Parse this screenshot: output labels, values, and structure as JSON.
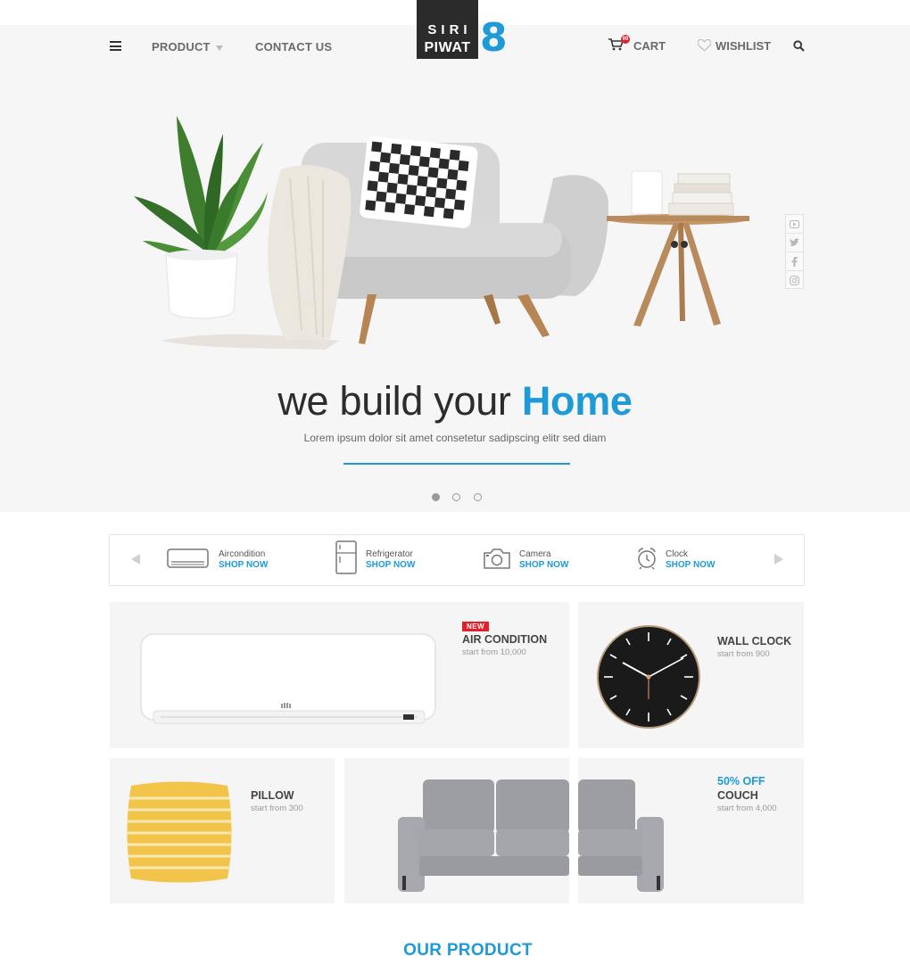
{
  "header": {
    "product_label": "PRODUCT",
    "contact_label": "CONTACT US",
    "logo_line1": "SIRI",
    "logo_line2": "PIWAT",
    "logo_digit": "8",
    "cart_label": "CART",
    "cart_count": "99",
    "wishlist_label": "WISHLIST",
    "icons": [
      "menu-icon",
      "caret-down-icon",
      "cart-icon",
      "heart-icon",
      "search-icon"
    ]
  },
  "hero": {
    "headline_prefix": "we build your ",
    "headline_accent": "Home",
    "subtitle": "Lorem ipsum dolor sit amet consetetur sadipscing elitr sed diam",
    "slides": 3,
    "active_slide": 1
  },
  "social": [
    "youtube-icon",
    "twitter-icon",
    "facebook-icon",
    "instagram-icon"
  ],
  "categories": {
    "items": [
      {
        "name": "Aircondition",
        "action": "SHOP NOW",
        "icon": "aircondition-icon"
      },
      {
        "name": "Refrigerator",
        "action": "SHOP NOW",
        "icon": "refrigerator-icon"
      },
      {
        "name": "Camera",
        "action": "SHOP NOW",
        "icon": "camera-icon"
      },
      {
        "name": "Clock",
        "action": "SHOP NOW",
        "icon": "clock-icon"
      }
    ]
  },
  "products": {
    "air": {
      "badge": "NEW",
      "title": "AIR CONDITION",
      "price": "start from 10,000"
    },
    "clock": {
      "title": "WALL CLOCK",
      "price": "start from 900"
    },
    "pillow": {
      "title": "PILLOW",
      "price": "start from 300"
    },
    "couch": {
      "offer": "50% OFF",
      "title": "COUCH",
      "price": "start from 4,000"
    }
  },
  "section_title": "OUR PRODUCT",
  "colors": {
    "accent": "#1e9ad6",
    "badge": "#e0212b",
    "dark": "#2b2b2b",
    "tile": "#f5f5f5",
    "hero": "#f6f6f6"
  }
}
